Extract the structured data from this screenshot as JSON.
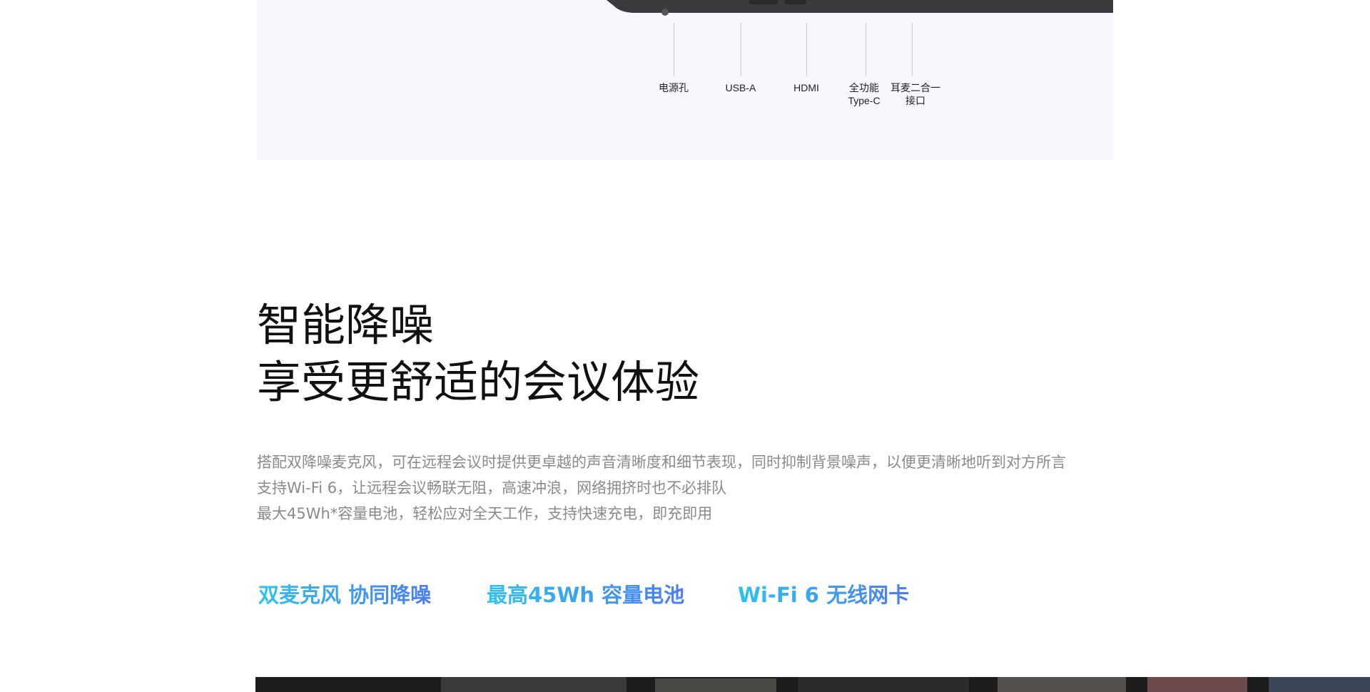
{
  "ports": [
    {
      "label": "电源孔"
    },
    {
      "label": "USB-A"
    },
    {
      "label": "HDMI"
    },
    {
      "label": "全功能\nType-C"
    },
    {
      "label": "耳麦二合一\n接口"
    }
  ],
  "feature": {
    "headline_line1": "智能降噪",
    "headline_line2": "享受更舒适的会议体验",
    "description": [
      "搭配双降噪麦克风，可在远程会议时提供更卓越的声音清晰度和细节表现，同时抑制背景噪声，以便更清晰地听到对方所言",
      "支持Wi-Fi 6，让远程会议畅联无阻，高速冲浪，网络拥挤时也不必排队",
      "最大45Wh*容量电池，轻松应对全天工作，支持快速充电，即充即用"
    ],
    "highlights": [
      "双麦克风 协同降噪",
      "最高45Wh 容量电池",
      "Wi-Fi 6 无线网卡"
    ],
    "highlight_gradient": [
      "#2fc2f0",
      "#4b7df1"
    ]
  }
}
